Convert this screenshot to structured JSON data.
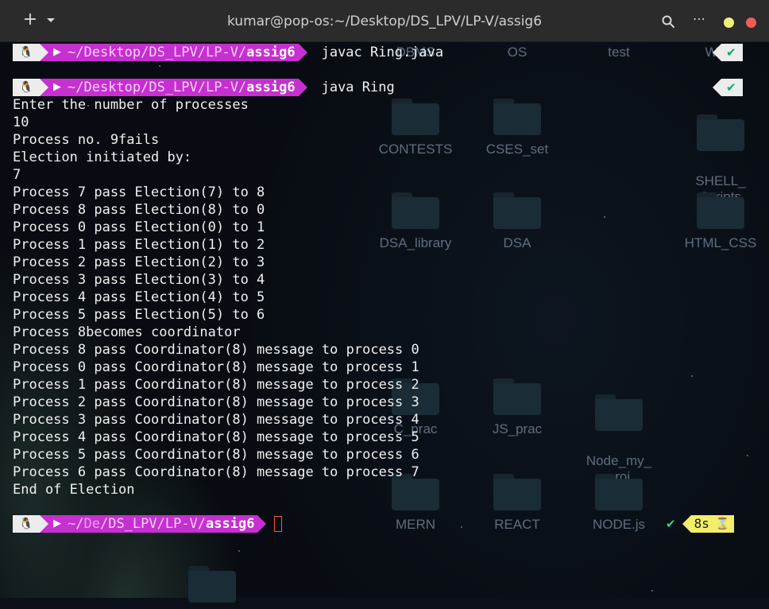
{
  "window": {
    "title": "kumar@pop-os:~/Desktop/DS_LPV/LP-V/assig6",
    "new_tab_icon": "plus-icon",
    "tab_menu_icon": "chevron-down-icon",
    "search_icon": "search-icon",
    "menu_icon": "ellipsis-icon",
    "colors": {
      "titlebar": "#2b2b2b",
      "minimize": "#f0f07a",
      "close": "#f45a5a"
    }
  },
  "desktop": {
    "icons": [
      {
        "label": "DBMS"
      },
      {
        "label": "OS"
      },
      {
        "label": "test"
      },
      {
        "label": "WAD"
      },
      {
        "label": "CONTESTS"
      },
      {
        "label": "CSES_set"
      },
      {
        "label": "SHELL_\nScripts"
      },
      {
        "label": "DSA_library"
      },
      {
        "label": "DSA"
      },
      {
        "label": "HTML_CSS"
      },
      {
        "label": "C_prac"
      },
      {
        "label": "JS_prac"
      },
      {
        "label": "Node_my_\nproj"
      },
      {
        "label": "MERN"
      },
      {
        "label": "REACT"
      },
      {
        "label": "NODE.js"
      }
    ]
  },
  "terminal": {
    "colors": {
      "prompt_path_bg": "#c62fd0",
      "prompt_os_bg": "#ececec",
      "status_ok": "#2fd18a",
      "timer_bg": "#f2ee6a",
      "cursor": "#f45c2c"
    },
    "prompts": [
      {
        "os_icon": "linux-tux-icon",
        "path_prefix": "~/Desktop/DS_LPV/LP-V/",
        "path_dir": "assig6",
        "command": "javac Ring.java",
        "status": "✔"
      },
      {
        "os_icon": "linux-tux-icon",
        "path_prefix": "~/Desktop/DS_LPV/LP-V/",
        "path_dir": "assig6",
        "command": "java Ring",
        "status": "✔"
      },
      {
        "os_icon": "linux-tux-icon",
        "path_home": "~/",
        "path_dim": "De",
        "path_prefix": "/DS_LPV/LP-V/",
        "path_dir": "assig6",
        "command": "",
        "status": "✔",
        "duration": "8s",
        "duration_icon": "hourglass-icon"
      }
    ],
    "output": [
      "Enter the number of processes",
      "10",
      "Process no. 9fails",
      "Election initiated by:",
      "7",
      "Process 7 pass Election(7) to 8",
      "Process 8 pass Election(8) to 0",
      "Process 0 pass Election(0) to 1",
      "Process 1 pass Election(1) to 2",
      "Process 2 pass Election(2) to 3",
      "Process 3 pass Election(3) to 4",
      "Process 4 pass Election(4) to 5",
      "Process 5 pass Election(5) to 6",
      "Process 8becomes coordinator",
      "Process 8 pass Coordinator(8) message to process 0",
      "Process 0 pass Coordinator(8) message to process 1",
      "Process 1 pass Coordinator(8) message to process 2",
      "Process 2 pass Coordinator(8) message to process 3",
      "Process 3 pass Coordinator(8) message to process 4",
      "Process 4 pass Coordinator(8) message to process 5",
      "Process 5 pass Coordinator(8) message to process 6",
      "Process 6 pass Coordinator(8) message to process 7",
      "End of Election"
    ]
  }
}
